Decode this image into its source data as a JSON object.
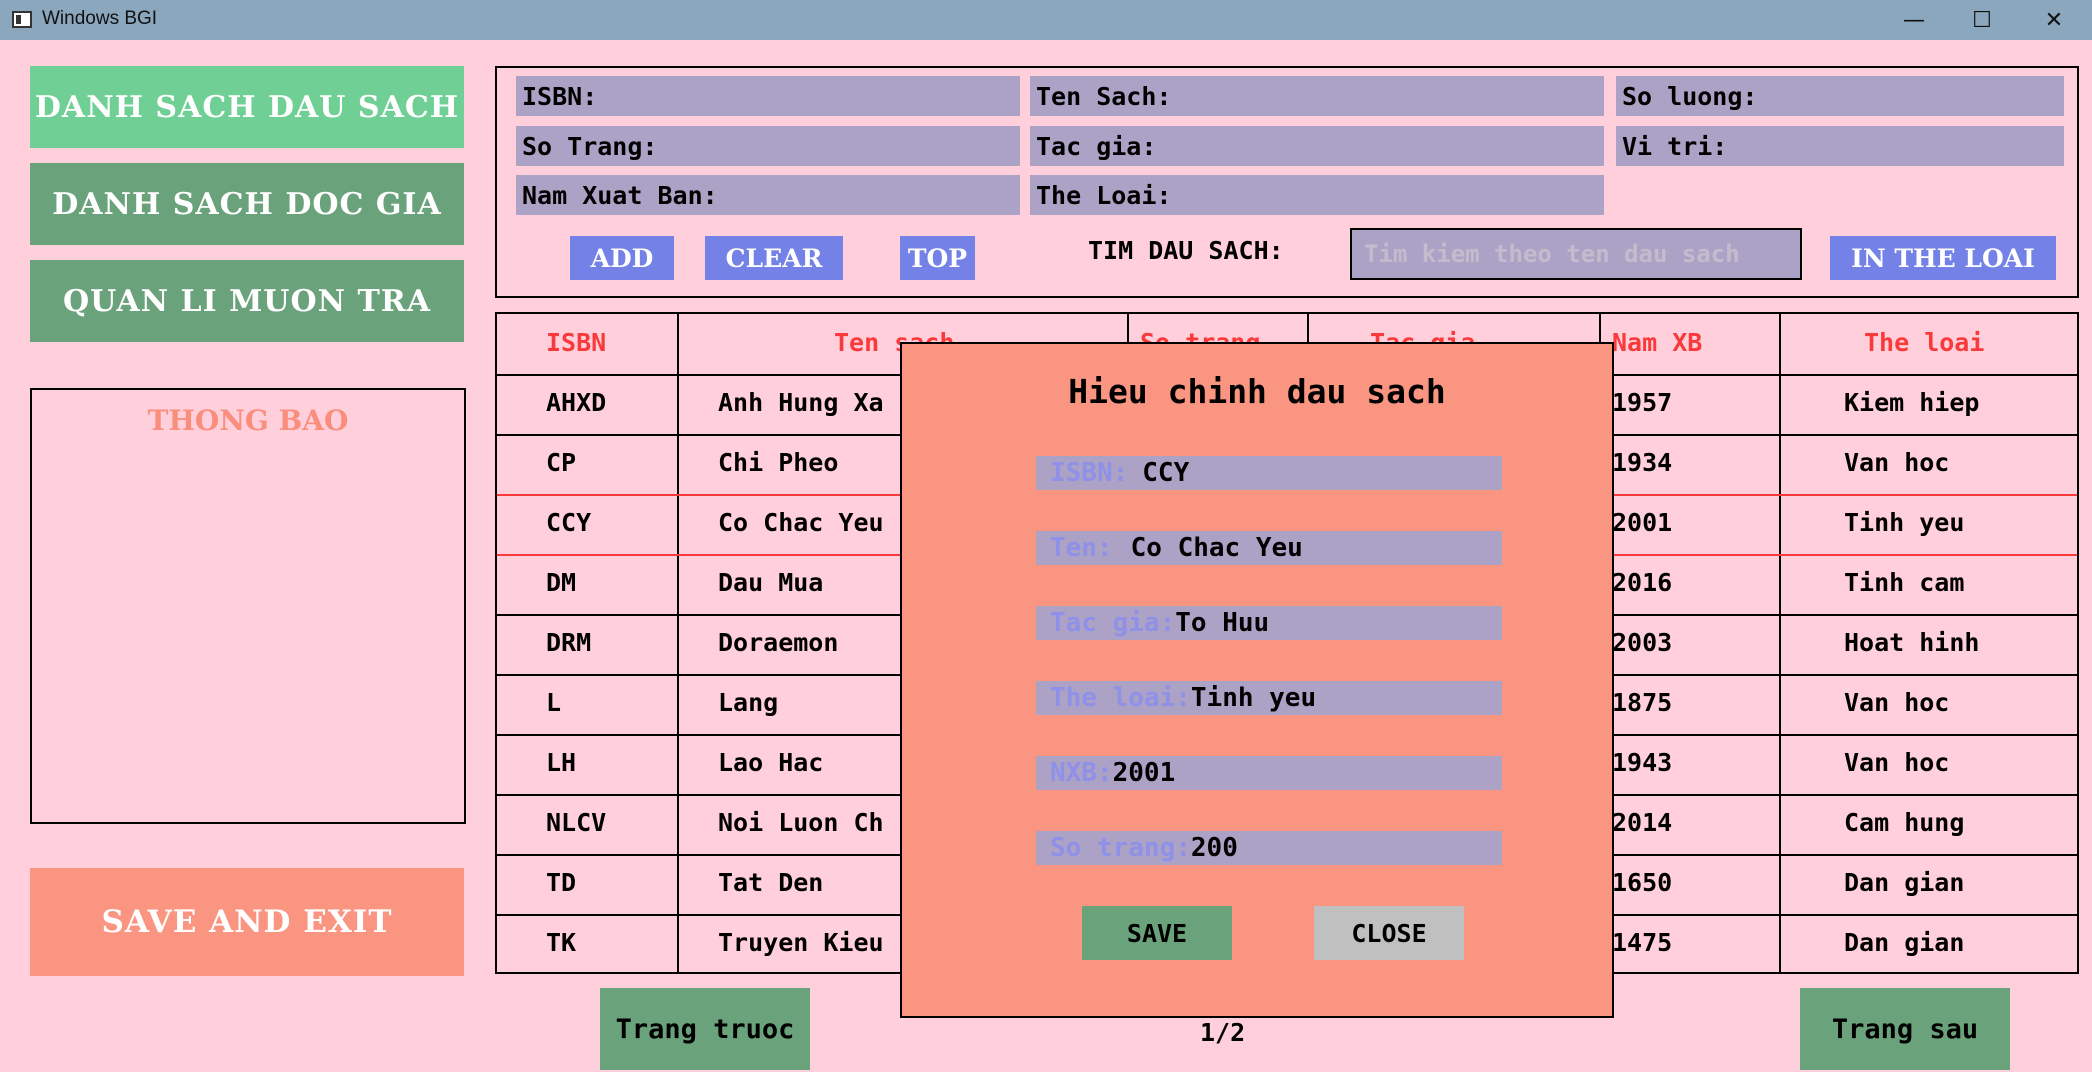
{
  "window": {
    "title": "Windows BGI",
    "minimize": "—",
    "maximize": "☐",
    "close": "✕"
  },
  "sidebar": {
    "btn_dau_sach": "DANH SACH DAU SACH",
    "btn_doc_gia": "DANH SACH DOC GIA",
    "btn_muon_tra": "QUAN LI MUON TRA",
    "thong_bao": "THONG BAO",
    "save_exit": "SAVE AND EXIT"
  },
  "form": {
    "isbn": "ISBN:",
    "ten_sach": "Ten Sach:",
    "so_luong": "So luong:",
    "so_trang": "So Trang:",
    "tac_gia": "Tac gia:",
    "vi_tri": "Vi tri:",
    "nam_xb": "Nam Xuat Ban:",
    "the_loai": "The Loai:",
    "btn_add": "ADD",
    "btn_clear": "CLEAR",
    "btn_top": "TOP",
    "search_label": "TIM DAU SACH:",
    "search_placeholder": "Tim kiem theo ten dau sach",
    "btn_in_the_loai": "IN THE LOAI"
  },
  "table": {
    "headers": [
      "ISBN",
      "Ten sach",
      "So trang",
      "Tac gia",
      "Nam XB",
      "The loai"
    ],
    "rows": [
      {
        "isbn": "AHXD",
        "ten": "Anh Hung Xa",
        "nam": "1957",
        "loai": "Kiem hiep"
      },
      {
        "isbn": "CP",
        "ten": "Chi Pheo",
        "nam": "1934",
        "loai": "Van hoc"
      },
      {
        "isbn": "CCY",
        "ten": "Co Chac Yeu",
        "nam": "2001",
        "loai": "Tinh yeu"
      },
      {
        "isbn": "DM",
        "ten": "Dau Mua",
        "nam": "2016",
        "loai": "Tinh cam"
      },
      {
        "isbn": "DRM",
        "ten": "Doraemon",
        "nam": "2003",
        "loai": "Hoat hinh"
      },
      {
        "isbn": "L",
        "ten": "Lang",
        "nam": "1875",
        "loai": "Van hoc"
      },
      {
        "isbn": "LH",
        "ten": "Lao Hac",
        "nam": "1943",
        "loai": "Van hoc"
      },
      {
        "isbn": "NLCV",
        "ten": "Noi Luon Ch",
        "nam": "2014",
        "loai": "Cam hung"
      },
      {
        "isbn": "TD",
        "ten": "Tat Den",
        "nam": "1650",
        "loai": "Dan gian"
      },
      {
        "isbn": "TK",
        "ten": "Truyen Kieu",
        "nam": "1475",
        "loai": "Dan gian"
      }
    ],
    "selected_row_index": 2
  },
  "pager": {
    "prev": "Trang truoc",
    "page": "1/2",
    "next": "Trang sau"
  },
  "modal": {
    "title": "Hieu chinh dau sach",
    "fields": [
      {
        "label": "ISBN:",
        "value": "CCY"
      },
      {
        "label": "Ten:",
        "value": "Co Chac Yeu"
      },
      {
        "label": "Tac gia:",
        "value": "To Huu"
      },
      {
        "label": "The loai:",
        "value": "Tinh yeu"
      },
      {
        "label": "NXB:",
        "value": "2001"
      },
      {
        "label": "So trang:",
        "value": "200"
      }
    ],
    "save": "SAVE",
    "close": "CLOSE"
  },
  "colors": {
    "background": "#ffcfdc",
    "active_sidebar": "#6fcf94",
    "sidebar": "#6aa27b",
    "save_exit": "#fa9582",
    "field": "#aba2c6",
    "accent_blue": "#7482e8",
    "header_red": "#fa3a3a",
    "modal": "#fa9582"
  }
}
